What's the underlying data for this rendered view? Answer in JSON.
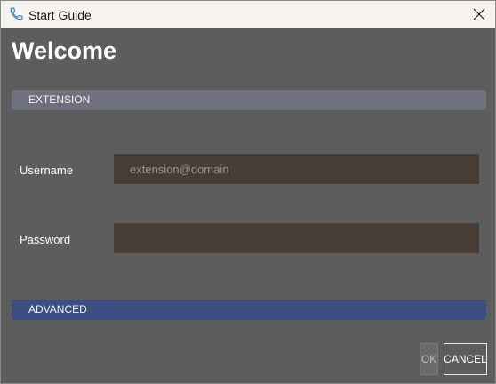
{
  "window": {
    "title": "Start Guide"
  },
  "heading": "Welcome",
  "sections": {
    "extension": "EXTENSION",
    "advanced": "ADVANCED"
  },
  "fields": {
    "username": {
      "label": "Username",
      "placeholder": "extension@domain",
      "value": ""
    },
    "password": {
      "label": "Password",
      "placeholder": "",
      "value": ""
    }
  },
  "buttons": {
    "ok": "OK",
    "cancel": "CANCEL"
  },
  "icons": {
    "app": "phone-icon",
    "close": "close-icon"
  },
  "colors": {
    "accent": "#3c4f82",
    "input_bg": "#473d35",
    "dialog_bg": "#5d5d5d"
  }
}
